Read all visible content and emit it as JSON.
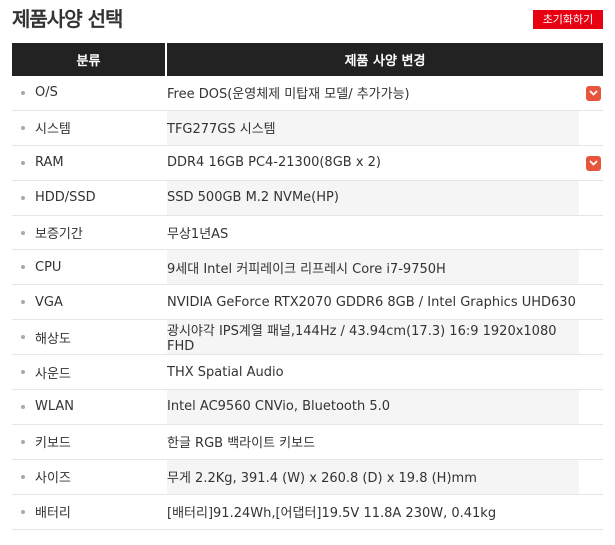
{
  "page": {
    "title": "제품사양 선택",
    "reset_label": "초기화하기"
  },
  "table": {
    "headers": [
      "분류",
      "제품 사양 변경"
    ],
    "rows": [
      {
        "label": "O/S",
        "value": "Free DOS(운영체제 미탑재 모델/ 추가가능)",
        "dropdown": true
      },
      {
        "label": "시스템",
        "value": "TFG277GS 시스템",
        "dropdown": false
      },
      {
        "label": "RAM",
        "value": "DDR4 16GB PC4-21300(8GB x 2)",
        "dropdown": true
      },
      {
        "label": "HDD/SSD",
        "value": "SSD 500GB M.2 NVMe(HP)",
        "dropdown": false
      },
      {
        "label": "보증기간",
        "value": "무상1년AS",
        "dropdown": false
      },
      {
        "label": "CPU",
        "value": "9세대 Intel 커피레이크 리프레시 Core i7-9750H",
        "dropdown": false
      },
      {
        "label": "VGA",
        "value": "NVIDIA GeForce RTX2070 GDDR6 8GB / Intel Graphics UHD630",
        "dropdown": false
      },
      {
        "label": "해상도",
        "value": "광시야각 IPS계열 패널,144Hz / 43.94cm(17.3) 16:9 1920x1080 FHD",
        "dropdown": false
      },
      {
        "label": "사운드",
        "value": "THX Spatial Audio",
        "dropdown": false
      },
      {
        "label": "WLAN",
        "value": "Intel AC9560 CNVio, Bluetooth 5.0",
        "dropdown": false
      },
      {
        "label": "키보드",
        "value": "한글 RGB 백라이트 키보드",
        "dropdown": false
      },
      {
        "label": "사이즈",
        "value": "무게 2.2Kg, 391.4 (W) x 260.8 (D) x 19.8 (H)mm",
        "dropdown": false
      },
      {
        "label": "배터리",
        "value": "[배터리]91.24Wh,[어댑터]19.5V 11.8A 230W, 0.41kg",
        "dropdown": false
      }
    ]
  },
  "colors": {
    "accent": "#e60012",
    "header_bg": "#222222",
    "dropdown": "#e8553c"
  }
}
